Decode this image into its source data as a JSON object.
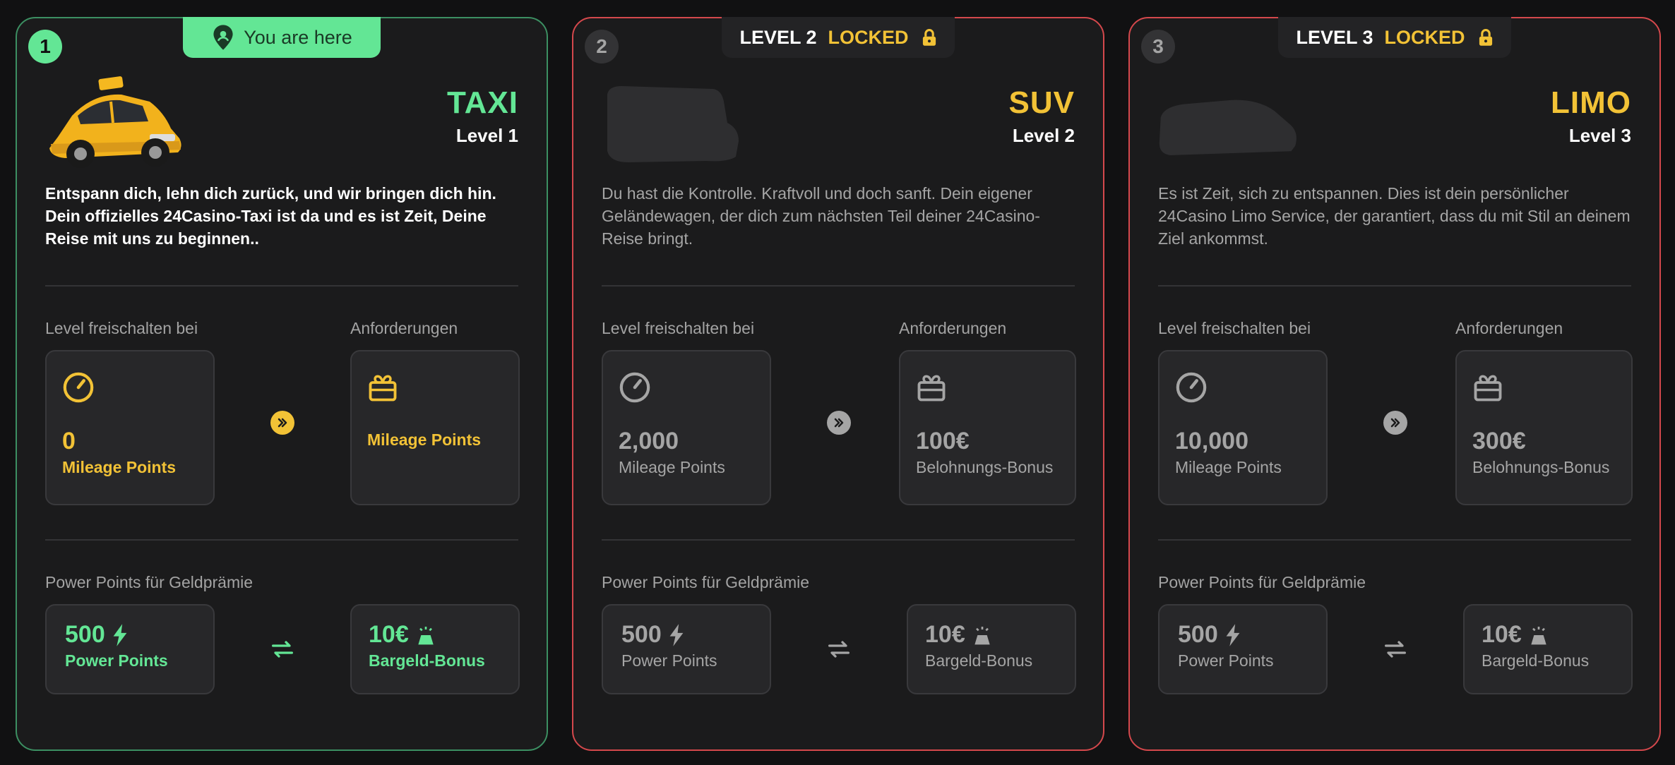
{
  "colors": {
    "accent_green": "#63e695",
    "accent_yellow": "#f2c236",
    "locked_border": "#d4484c",
    "active_border": "#3c8f62"
  },
  "cards": [
    {
      "number": "1",
      "tag": "You are here",
      "name": "TAXI",
      "level": "Level 1",
      "description": "Entspann dich, lehn dich zurück, und wir bringen dich hin. Dein offizielles 24Casino-Taxi ist da und es ist Zeit, Deine Reise mit uns zu beginnen..",
      "unlock_label": "Level freischalten bei",
      "unlock_value": "0",
      "unlock_unit": "Mileage Points",
      "req_label": "Anforderungen",
      "req_value": "",
      "req_unit": "Mileage Points",
      "power_label": "Power Points für Geldprämie",
      "power_value": "500",
      "power_unit": "Power Points",
      "cash_value": "10€",
      "cash_unit": "Bargeld-Bonus"
    },
    {
      "number": "2",
      "tag_level": "LEVEL 2",
      "tag_locked": "LOCKED",
      "name": "SUV",
      "level": "Level 2",
      "description": "Du hast die Kontrolle. Kraftvoll und doch sanft. Dein eigener Geländewagen, der dich zum nächsten Teil deiner 24Casino-Reise bringt.",
      "unlock_label": "Level freischalten bei",
      "unlock_value": "2,000",
      "unlock_unit": "Mileage Points",
      "req_label": "Anforderungen",
      "req_value": "100€",
      "req_unit": "Belohnungs-Bonus",
      "power_label": "Power Points für Geldprämie",
      "power_value": "500",
      "power_unit": "Power Points",
      "cash_value": "10€",
      "cash_unit": "Bargeld-Bonus"
    },
    {
      "number": "3",
      "tag_level": "LEVEL 3",
      "tag_locked": "LOCKED",
      "name": "LIMO",
      "level": "Level 3",
      "description": "Es ist Zeit, sich zu entspannen. Dies ist dein persönlicher 24Casino Limo Service, der garantiert, dass du mit Stil an deinem Ziel ankommst.",
      "unlock_label": "Level freischalten bei",
      "unlock_value": "10,000",
      "unlock_unit": "Mileage Points",
      "req_label": "Anforderungen",
      "req_value": "300€",
      "req_unit": "Belohnungs-Bonus",
      "power_label": "Power Points für Geldprämie",
      "power_value": "500",
      "power_unit": "Power Points",
      "cash_value": "10€",
      "cash_unit": "Bargeld-Bonus"
    }
  ]
}
